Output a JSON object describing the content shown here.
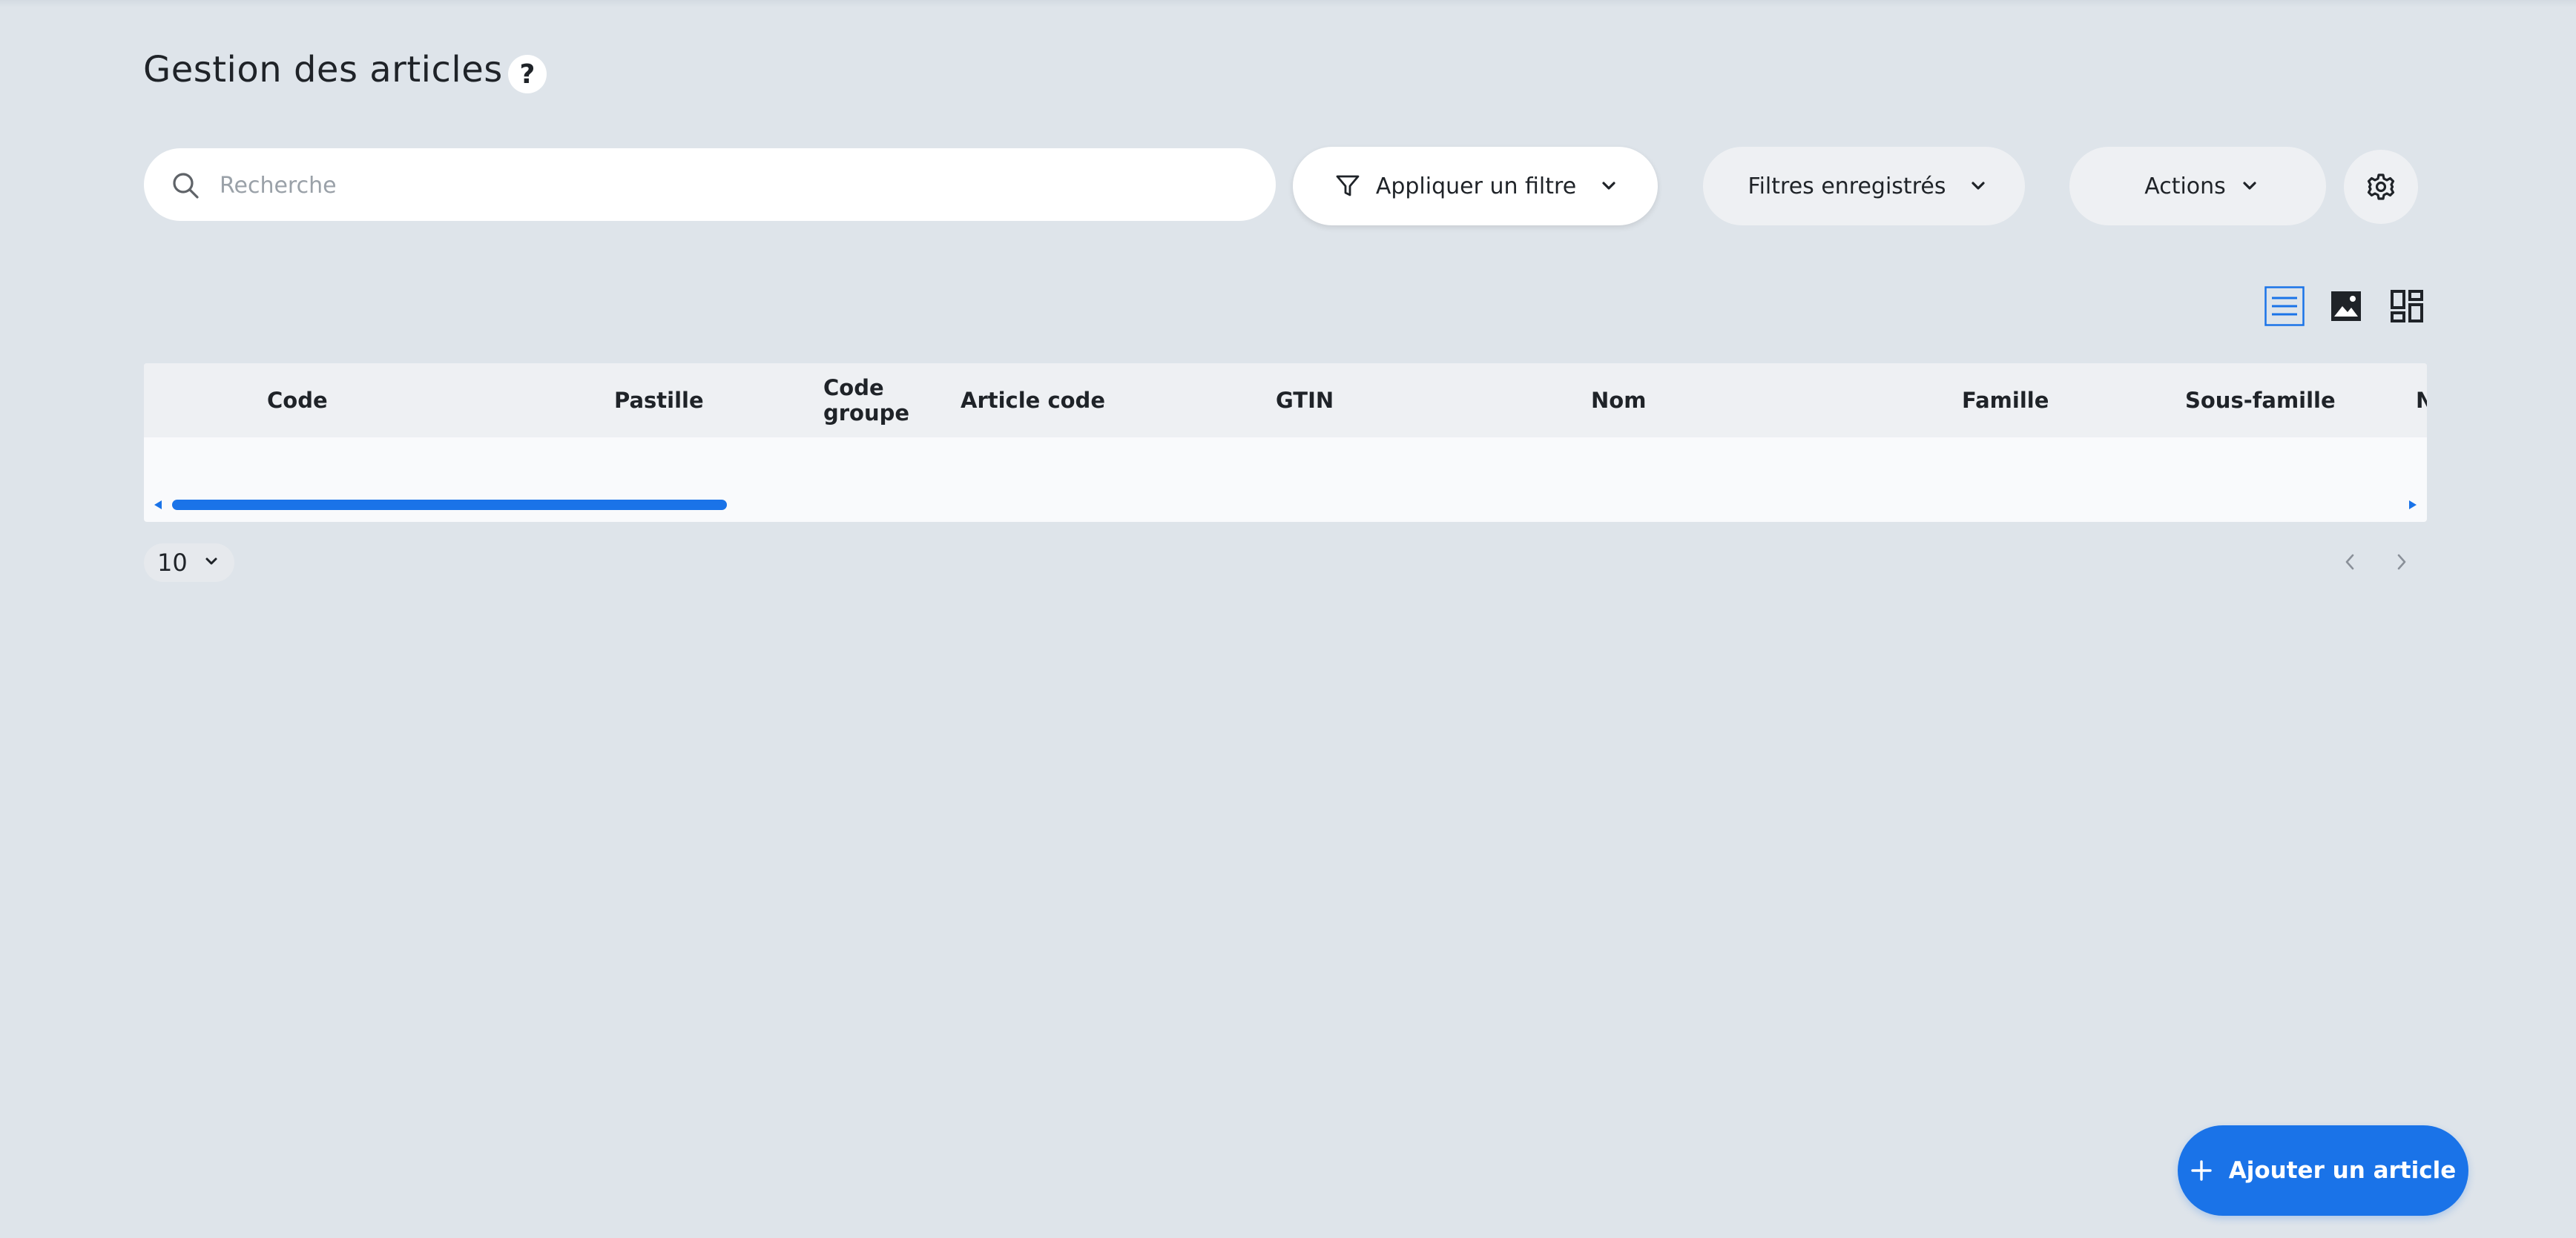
{
  "page": {
    "title": "Gestion des articles",
    "help_label": "?"
  },
  "toolbar": {
    "search_placeholder": "Recherche",
    "filter_label": "Appliquer un filtre",
    "saved_filters_label": "Filtres enregistrés",
    "actions_label": "Actions",
    "settings_icon": "gear-icon"
  },
  "view_modes": [
    {
      "name": "list",
      "icon": "list-view-icon",
      "active": true
    },
    {
      "name": "image",
      "icon": "image-view-icon",
      "active": false
    },
    {
      "name": "grid",
      "icon": "grid-view-icon",
      "active": false
    }
  ],
  "table": {
    "columns": [
      "Code",
      "Pastille",
      "Code groupe",
      "Article code",
      "GTIN",
      "Nom",
      "Famille",
      "Sous-famille",
      "N"
    ],
    "rows": []
  },
  "pagination": {
    "page_size": "10"
  },
  "fab": {
    "label": "Ajouter un article"
  },
  "colors": {
    "accent": "#1a73e8",
    "background": "#dee4ea",
    "pill": "#eef0f3"
  }
}
